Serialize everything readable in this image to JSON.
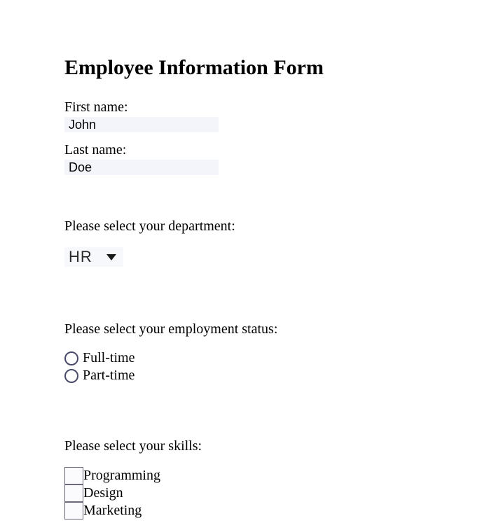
{
  "title": "Employee Information Form",
  "firstName": {
    "label": "First name:",
    "value": "John"
  },
  "lastName": {
    "label": "Last name:",
    "value": "Doe"
  },
  "department": {
    "prompt": "Please select your department:",
    "selected": "HR"
  },
  "employmentStatus": {
    "prompt": "Please select your employment status:",
    "options": {
      "fullTime": "Full-time",
      "partTime": "Part-time"
    }
  },
  "skills": {
    "prompt": "Please select your skills:",
    "options": {
      "programming": "Programming",
      "design": "Design",
      "marketing": "Marketing"
    }
  }
}
